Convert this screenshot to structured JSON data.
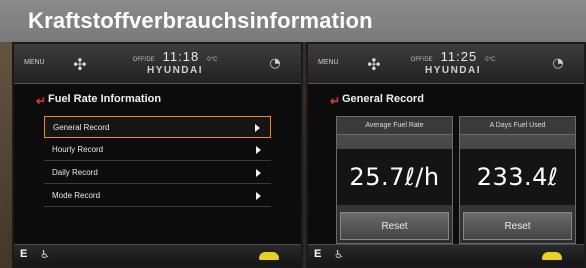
{
  "page_title": "Kraftstoffverbrauchsinformation",
  "left_screen": {
    "menu_label": "MENU",
    "status_small_left": "OFF/DE",
    "time": "11:18",
    "status_small_right": "0°C",
    "brand": "HYUNDAI",
    "panel_title": "Fuel Rate Information",
    "items": [
      {
        "label": "General Record",
        "selected": true
      },
      {
        "label": "Hourly Record",
        "selected": false
      },
      {
        "label": "Daily Record",
        "selected": false
      },
      {
        "label": "Mode Record",
        "selected": false
      }
    ],
    "bottom_letter": "E"
  },
  "right_screen": {
    "menu_label": "MENU",
    "status_small_left": "OFF/DE",
    "time": "11:25",
    "status_small_right": "0°C",
    "brand": "HYUNDAI",
    "panel_title": "General Record",
    "card_average": {
      "title": "Average Fuel Rate",
      "value": "25.7ℓ/h",
      "reset": "Reset"
    },
    "card_days": {
      "title": "A Days Fuel Used",
      "value": "233.4ℓ",
      "reset": "Reset"
    },
    "bottom_letter": "E"
  },
  "colors": {
    "title_bar": "#7a7a7a",
    "selection_border": "#e88a1e",
    "back_arrow": "#e23a2a",
    "car_indicator": "#e7d21f"
  },
  "icons": {
    "fan": "fan-icon",
    "gauge": "gauge-icon",
    "back": "back-arrow-icon",
    "arrow": "right-arrow-icon",
    "seat": "seat-icon",
    "car": "car-icon"
  }
}
